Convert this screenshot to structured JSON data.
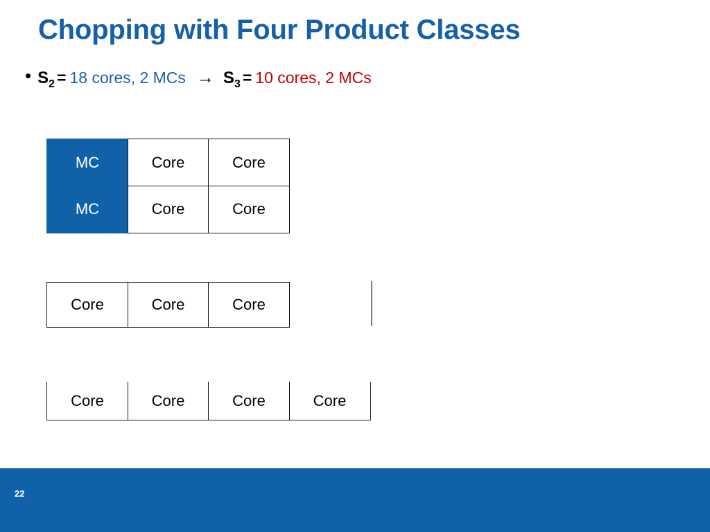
{
  "slide": {
    "title": "Chopping with Four Product Classes",
    "page_number": "22",
    "accent_blue": "#1161a8",
    "title_blue": "#1560a8",
    "value_blue": "#1f5fa9",
    "value_red": "#c00000"
  },
  "bullet": {
    "marker": "•",
    "left_symbol": "S",
    "left_subscript": "2",
    "left_equals": "=",
    "left_value": "18 cores, 2 MCs",
    "arrow": "→",
    "right_symbol": "S",
    "right_subscript": "3",
    "right_equals": "=",
    "right_value": "10 cores, 2 MCs"
  },
  "diagram": {
    "grid_s2": {
      "rows": [
        [
          "MC",
          "Core",
          "Core"
        ],
        [
          "MC",
          "Core",
          "Core"
        ]
      ]
    },
    "grid_row3": {
      "rows": [
        [
          "Core",
          "Core",
          "Core"
        ]
      ]
    },
    "grid_row4": {
      "rows": [
        [
          "Core",
          "Core",
          "Core",
          "Core"
        ]
      ]
    }
  }
}
